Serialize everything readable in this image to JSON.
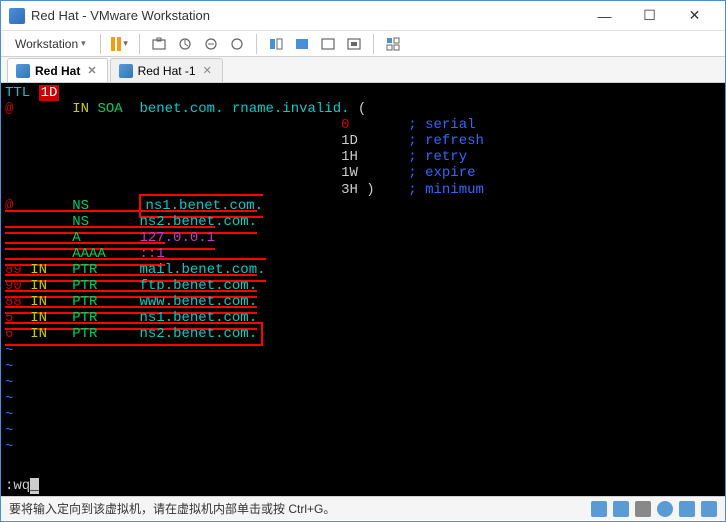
{
  "window": {
    "title": "Red Hat  - VMware Workstation"
  },
  "menubar": {
    "workstation": "Workstation"
  },
  "tabs": [
    {
      "label": "Red Hat",
      "active": true
    },
    {
      "label": "Red Hat -1",
      "active": false
    }
  ],
  "terminal": {
    "ttl_label": "TTL",
    "ttl_value": "1D",
    "soa_at": "@",
    "soa_in": "IN",
    "soa_key": "SOA",
    "soa_domain": "benet.com.",
    "soa_rname": "rname.invalid.",
    "soa_open": "(",
    "soa_close": ")",
    "soa_fields": [
      {
        "value": "0",
        "comment": "; serial"
      },
      {
        "value": "1D",
        "comment": "; refresh"
      },
      {
        "value": "1H",
        "comment": "; retry"
      },
      {
        "value": "1W",
        "comment": "; expire"
      },
      {
        "value": "3H",
        "comment": "; minimum"
      }
    ],
    "records": [
      {
        "owner": "@",
        "class": "",
        "type": "NS",
        "rdata": "ns1.benet.com."
      },
      {
        "owner": "",
        "class": "",
        "type": "NS",
        "rdata": "ns2.benet.com."
      },
      {
        "owner": "",
        "class": "",
        "type": "A",
        "rdata": "127.0.0.1"
      },
      {
        "owner": "",
        "class": "",
        "type": "AAAA",
        "rdata": "::1"
      },
      {
        "owner": "89",
        "class": "IN",
        "type": "PTR",
        "rdata": "mail.benet.com."
      },
      {
        "owner": "90",
        "class": "IN",
        "type": "PTR",
        "rdata": "ftp.benet.com."
      },
      {
        "owner": "88",
        "class": "IN",
        "type": "PTR",
        "rdata": "www.benet.com."
      },
      {
        "owner": "5",
        "class": "IN",
        "type": "PTR",
        "rdata": "ns1.benet.com."
      },
      {
        "owner": "6",
        "class": "IN",
        "type": "PTR",
        "rdata": "ns2.benet.com."
      }
    ],
    "tilde": "~",
    "command": ":wq"
  },
  "statusbar": {
    "hint": "要将输入定向到该虚拟机，请在虚拟机内部单击或按 Ctrl+G。"
  }
}
